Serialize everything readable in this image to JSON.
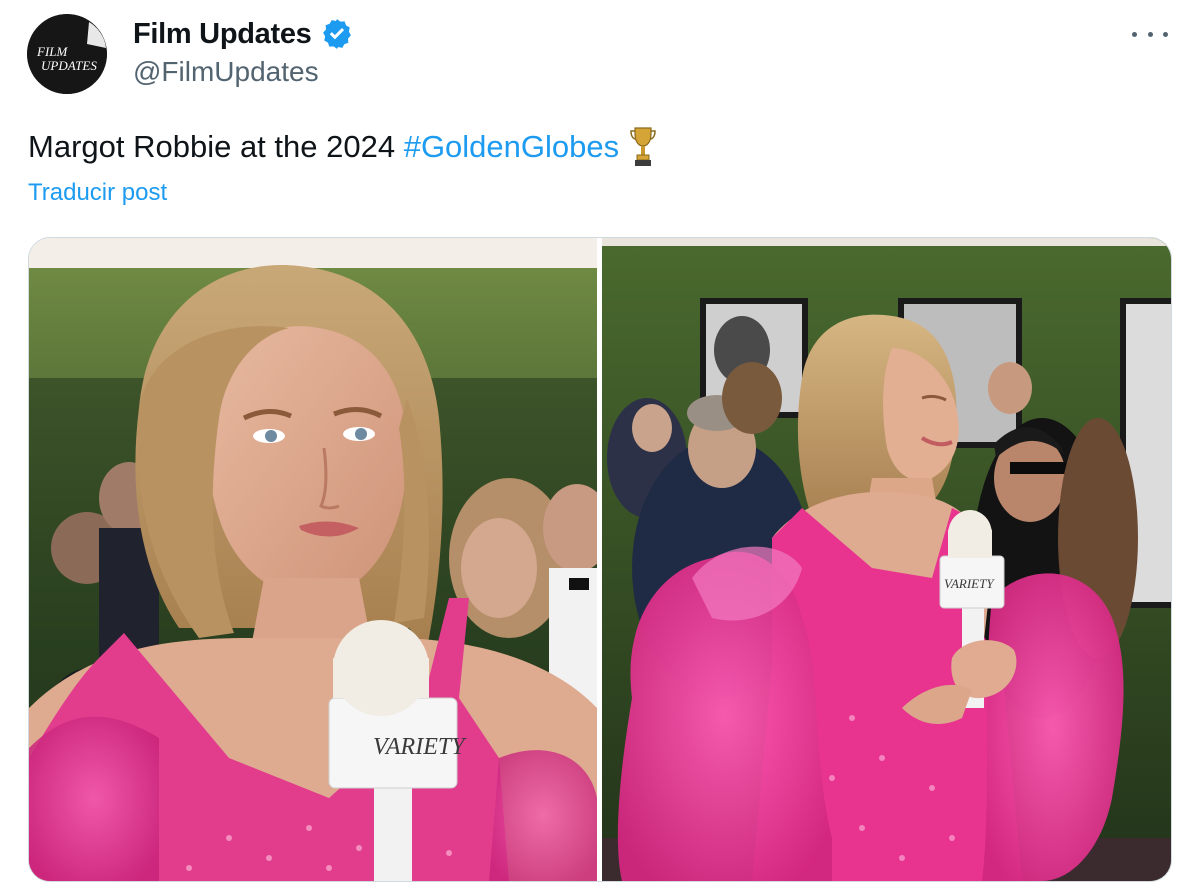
{
  "account": {
    "display_name": "Film Updates",
    "handle": "@FilmUpdates",
    "verified": true,
    "avatar_text_line1": "FILM",
    "avatar_text_line2": "UPDATES"
  },
  "post": {
    "text_prefix": "Margot Robbie at the 2024 ",
    "hashtag": "#GoldenGlobes",
    "emoji": "trophy-icon",
    "translate_label": "Traducir post"
  },
  "media": {
    "count": 2,
    "images": [
      {
        "name": "photo-left",
        "mic_label": "VARIETY"
      },
      {
        "name": "photo-right",
        "mic_label": "VARIETY"
      }
    ]
  },
  "colors": {
    "link": "#1d9bf0",
    "text": "#0f1419",
    "secondary": "#536471",
    "dress_pink": "#e8348f"
  },
  "icons": [
    "verified-badge-icon",
    "more-options-icon",
    "trophy-icon"
  ]
}
